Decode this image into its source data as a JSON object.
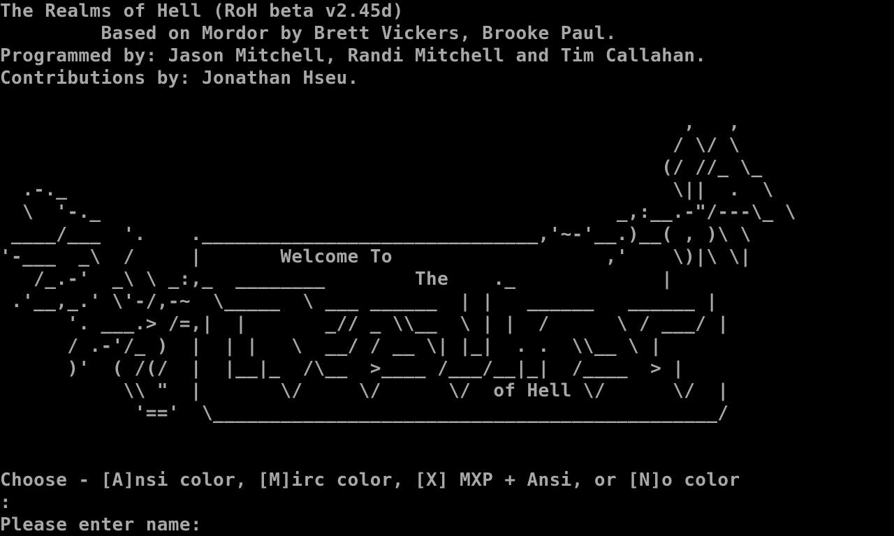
{
  "terminal": {
    "colors": {
      "background": "#000000",
      "foreground": "#a8a8a8"
    },
    "header": [
      "The Realms of Hell (RoH beta v2.45d)",
      "         Based on Mordor by Brett Vickers, Brooke Paul.",
      "Programmed by: Jason Mitchell, Randi Mitchell and Tim Callahan.",
      "Contributions by: Jonathan Hseu."
    ],
    "art": [
      "",
      "                                                             ,   ,",
      "                                                            / \\/ \\",
      "                                                           (/ //_ \\_",
      "  .-._                                                      \\||  .  \\",
      "  \\  '-._                                              _,:__.-\"/---\\_ \\",
      " ____/___  '.    .______________________________,'~-'__.)__( , )\\ \\",
      "'-___  _\\  /     |       Welcome To                   ,'    \\)|\\ \\|",
      "   /_.-'  _\\ \\ _:,_  ________        The    ._             |",
      " .'__,_.' \\'-/,-~  \\_____  \\ ___ ______  | |   ______   ______ |",
      "      '. ___.> /=,|  |       _// _ \\\\__  \\ | |  /      \\ / ___/ |",
      "      / .-'/_ )  |  | |   \\  __/ / __ \\| |_|  . .  \\\\__ \\ |",
      "      )'  ( /(/  |  |__|_  /\\__  >____ /___/__|_|  /____  > |",
      "           \\\\ \"  |       \\/     \\/      \\/  of Hell \\/      \\/  |",
      "            '=='  \\_____________________________________________/",
      "",
      ""
    ],
    "color_prompt": "Choose - [A]nsi color, [M]irc color, [X] MXP + Ansi, or [N]o color",
    "colon_line": ":",
    "name_prompt": "Please enter name: "
  }
}
